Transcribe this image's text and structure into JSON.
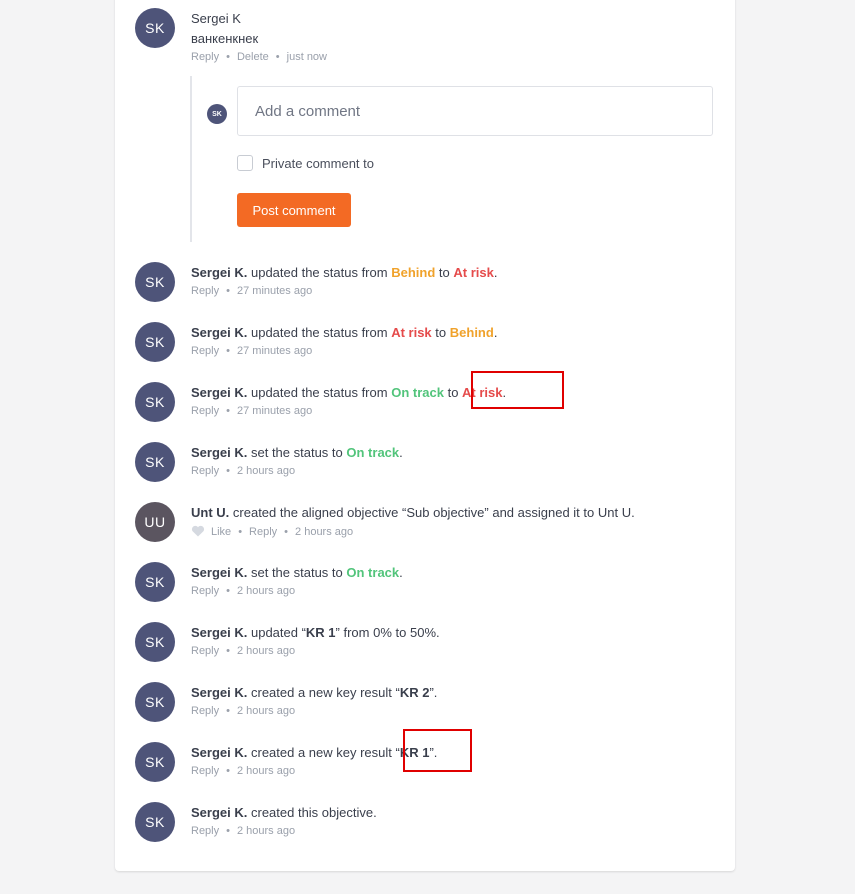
{
  "colors": {
    "accent": "#f36a24",
    "behind": "#f0a22b",
    "at_risk": "#e54b4b",
    "on_track": "#52c47b",
    "avatar_sk": "#4e5479",
    "avatar_uu": "#5b5560",
    "highlight": "#e00000"
  },
  "comment": {
    "author": "Sergei K",
    "initials": "SK",
    "text": "ванкенкнек",
    "actions": [
      "Reply",
      "Delete",
      "just now"
    ]
  },
  "reply_box": {
    "avatar_initials": "SK",
    "placeholder": "Add a comment",
    "private_label": "Private comment to",
    "post_label": "Post comment"
  },
  "activity": [
    {
      "initials": "SK",
      "name": "Sergei K.",
      "text": "updated the status from",
      "from": "Behind",
      "to_word": "to",
      "to": "At risk",
      "end": ".",
      "reply": "Reply",
      "time": "27 minutes ago"
    },
    {
      "initials": "SK",
      "name": "Sergei K.",
      "text": "updated the status from",
      "from": "At risk",
      "to_word": "to",
      "to": "Behind",
      "end": ".",
      "reply": "Reply",
      "time": "27 minutes ago"
    },
    {
      "initials": "SK",
      "name": "Sergei K.",
      "text": "updated the status from",
      "from": "On track",
      "to_word": "to",
      "to": "At risk",
      "end": ".",
      "reply": "Reply",
      "time": "27 minutes ago"
    },
    {
      "initials": "SK",
      "name": "Sergei K.",
      "text": "set the status to",
      "status": "On track",
      "end": ".",
      "reply": "Reply",
      "time": "2 hours ago"
    },
    {
      "initials": "UU",
      "name": "Unt U.",
      "text": "created the aligned objective “Sub objective” and assigned it to Unt U.",
      "like": "Like",
      "reply": "Reply",
      "time": "2 hours ago"
    },
    {
      "initials": "SK",
      "name": "Sergei K.",
      "text": "set the status to",
      "status": "On track",
      "end": ".",
      "reply": "Reply",
      "time": "2 hours ago"
    },
    {
      "initials": "SK",
      "name": "Sergei K.",
      "text": "updated “",
      "kr": "KR 1",
      "text2": "” from",
      "from": "0%",
      "to_word": "to",
      "to": "50%",
      "end": ".",
      "reply": "Reply",
      "time": "2 hours ago"
    },
    {
      "initials": "SK",
      "name": "Sergei K.",
      "text": "created a new key result “",
      "kr": "KR 2",
      "end": "”.",
      "reply": "Reply",
      "time": "2 hours ago"
    },
    {
      "initials": "SK",
      "name": "Sergei K.",
      "text": "created a new key result “",
      "kr": "KR 1",
      "end": "”.",
      "reply": "Reply",
      "time": "2 hours ago"
    },
    {
      "initials": "SK",
      "name": "Sergei K.",
      "text": "created this objective.",
      "reply": "Reply",
      "time": "2 hours ago"
    }
  ]
}
